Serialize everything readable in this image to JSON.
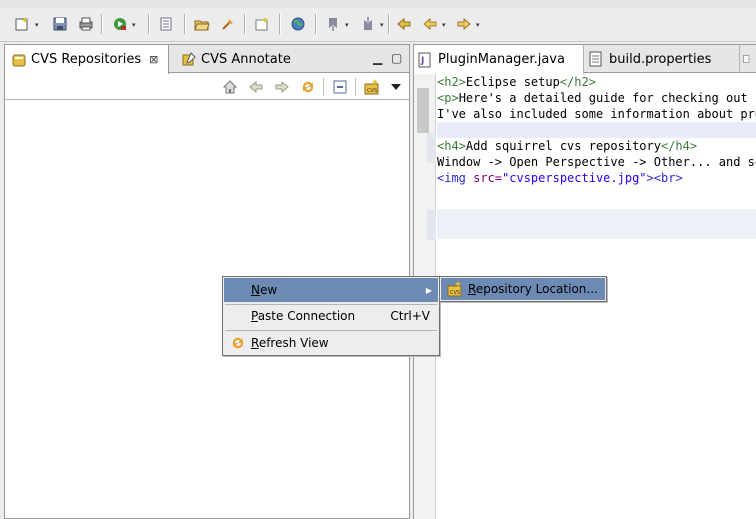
{
  "left_view": {
    "tabs": [
      {
        "label": "CVS Repositories",
        "close": "⊠"
      },
      {
        "label": "CVS Annotate"
      }
    ]
  },
  "editor": {
    "tabs": [
      {
        "label": "PluginManager.java"
      },
      {
        "label": "build.properties"
      }
    ],
    "lines": [
      {
        "parts": [
          [
            "tag",
            "<h2>"
          ],
          [
            "txt",
            "Eclipse setup"
          ],
          [
            "tag",
            "</h2>"
          ]
        ]
      },
      {
        "parts": [
          [
            "tag",
            "<p>"
          ],
          [
            "txt",
            "Here's a detailed guide for checking out sc"
          ]
        ]
      },
      {
        "parts": [
          [
            "txt",
            "I've also included some information about proj"
          ]
        ]
      },
      {
        "parts": [
          [
            "txt",
            ""
          ]
        ]
      },
      {
        "parts": [
          [
            "tag",
            "<h4>"
          ],
          [
            "txt",
            "Add squirrel cvs repository"
          ],
          [
            "tag",
            "</h4>"
          ]
        ]
      },
      {
        "parts": [
          [
            "txt",
            "Window -> Open Perspective -> Other... and sel"
          ]
        ]
      },
      {
        "parts": [
          [
            "tag2",
            "<img "
          ],
          [
            "attr",
            "src="
          ],
          [
            "str",
            "\"cvsperspective.jpg\""
          ],
          [
            "tag2",
            ">"
          ],
          [
            "tag2",
            "<br>"
          ]
        ]
      }
    ]
  },
  "context_menu": {
    "new": {
      "label_u": "N",
      "label_rest": "ew"
    },
    "paste": {
      "label_u": "P",
      "label_rest": "aste Connection",
      "accel": "Ctrl+V"
    },
    "refresh": {
      "label_u": "R",
      "label_rest": "efresh View"
    }
  },
  "submenu": {
    "repository_location": {
      "label_u": "R",
      "label_rest": "epository Location..."
    }
  },
  "colors": {
    "menu_selection": "#6c8ab4",
    "html_tag": "#3b7a3b"
  }
}
